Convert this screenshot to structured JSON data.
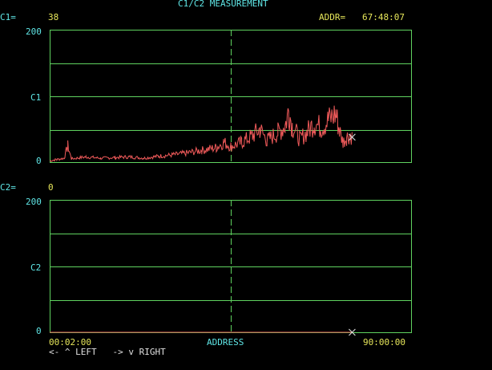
{
  "header": {
    "title": "C1/C2 MEASUREMENT",
    "c1_label": "C1=",
    "c1_value": "38",
    "addr_label": "ADDR=",
    "addr_value": "67:48:07",
    "c2_label": "C2=",
    "c2_value": "0"
  },
  "colors": {
    "background": "#000000",
    "label": "#5fe6e6",
    "value": "#e6e65a",
    "grid": "#5fd25f",
    "trace": "#f05a5a",
    "cursor": "#e0e0e0"
  },
  "plot_c1": {
    "y_max_label": "200",
    "y_mid_label": "C1",
    "y_min_label": "0"
  },
  "plot_c2": {
    "y_max_label": "200",
    "y_mid_label": "C2",
    "y_min_label": "0"
  },
  "footer": {
    "x_start_label": "00:02:00",
    "x_axis_label": "ADDRESS",
    "x_end_label": "90:00:00",
    "nav_hint": "<- ^ LEFT   -> v RIGHT"
  },
  "cursor": {
    "position_fraction": 0.835,
    "marker_glyph": "×"
  },
  "chart_data": [
    {
      "type": "line",
      "series": [
        {
          "values": [
            {
              "x": 0.0,
              "y": 2
            },
            {
              "x": 0.02,
              "y": 4
            },
            {
              "x": 0.04,
              "y": 6
            },
            {
              "x": 0.05,
              "y": 25
            },
            {
              "x": 0.06,
              "y": 5
            },
            {
              "x": 0.1,
              "y": 8
            },
            {
              "x": 0.14,
              "y": 6
            },
            {
              "x": 0.18,
              "y": 7
            },
            {
              "x": 0.22,
              "y": 8
            },
            {
              "x": 0.26,
              "y": 6
            },
            {
              "x": 0.3,
              "y": 9
            },
            {
              "x": 0.34,
              "y": 11
            },
            {
              "x": 0.38,
              "y": 14
            },
            {
              "x": 0.42,
              "y": 18
            },
            {
              "x": 0.46,
              "y": 22
            },
            {
              "x": 0.48,
              "y": 30
            },
            {
              "x": 0.5,
              "y": 24
            },
            {
              "x": 0.53,
              "y": 30
            },
            {
              "x": 0.56,
              "y": 40
            },
            {
              "x": 0.58,
              "y": 50
            },
            {
              "x": 0.6,
              "y": 33
            },
            {
              "x": 0.63,
              "y": 45
            },
            {
              "x": 0.65,
              "y": 55
            },
            {
              "x": 0.66,
              "y": 78
            },
            {
              "x": 0.67,
              "y": 55
            },
            {
              "x": 0.69,
              "y": 35
            },
            {
              "x": 0.71,
              "y": 45
            },
            {
              "x": 0.73,
              "y": 60
            },
            {
              "x": 0.75,
              "y": 52
            },
            {
              "x": 0.77,
              "y": 64
            },
            {
              "x": 0.79,
              "y": 74
            },
            {
              "x": 0.8,
              "y": 48
            },
            {
              "x": 0.81,
              "y": 30
            },
            {
              "x": 0.82,
              "y": 38
            },
            {
              "x": 0.83,
              "y": 42
            },
            {
              "x": 0.835,
              "y": 38
            }
          ]
        }
      ],
      "ylim": [
        0,
        200
      ]
    },
    {
      "type": "line",
      "series": [
        {
          "values": [
            {
              "x": 0.0,
              "y": 0
            },
            {
              "x": 0.835,
              "y": 0
            }
          ]
        }
      ],
      "ylim": [
        0,
        200
      ]
    }
  ]
}
